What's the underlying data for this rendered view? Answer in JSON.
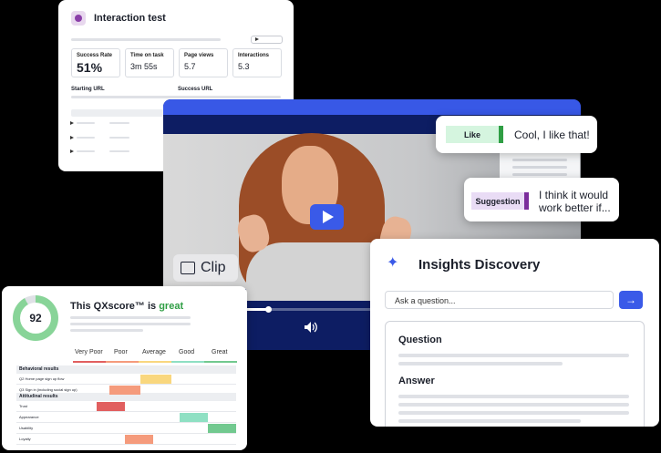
{
  "interaction_test": {
    "title": "Interaction test",
    "metrics": [
      {
        "label": "Success Rate",
        "value": "51%"
      },
      {
        "label": "Time on task",
        "value": "3m 55s"
      },
      {
        "label": "Page views",
        "value": "5.7"
      },
      {
        "label": "Interactions",
        "value": "5.3"
      }
    ],
    "starting_url_label": "Starting URL",
    "success_url_label": "Success URL"
  },
  "video": {
    "clip_label": "Clip",
    "progress": 0.19,
    "icons": [
      "play-icon",
      "clip-icon",
      "volume-icon"
    ]
  },
  "comments": [
    {
      "tag": "Like",
      "text": "Cool, I like that!",
      "tag_bg": "#d5f5df",
      "tag_accent": "#2f9e44"
    },
    {
      "tag": "Suggestion",
      "text": "I think it would work better if...",
      "tag_bg": "#e9dcf5",
      "tag_accent": "#7b2d9c"
    }
  ],
  "qx": {
    "score": "92",
    "title_prefix": "This QXscore™ is ",
    "title_emphasis": "great",
    "columns": [
      "Very Poor",
      "Poor",
      "Average",
      "Good",
      "Great"
    ],
    "sections": [
      {
        "name": "Behavioral results",
        "rows": [
          {
            "label": "Q2 Home page sign up flow",
            "rating": 2,
            "color": "#f9d77e"
          },
          {
            "label": "Q3 Sign in (including social sign up)",
            "rating": 1,
            "color": "#f59b7c"
          }
        ]
      },
      {
        "name": "Attitudinal results",
        "rows": [
          {
            "label": "Trust",
            "rating": 0,
            "color": "#e15f5f"
          },
          {
            "label": "Appearance",
            "rating": 3,
            "color": "#8fe0c3"
          },
          {
            "label": "Usability",
            "rating": 4,
            "color": "#72c98f"
          },
          {
            "label": "Loyalty",
            "rating": 1,
            "color": "#f59b7c"
          }
        ]
      }
    ]
  },
  "insights": {
    "title": "Insights Discovery",
    "placeholder": "Ask a question...",
    "question_label": "Question",
    "answer_label": "Answer"
  }
}
